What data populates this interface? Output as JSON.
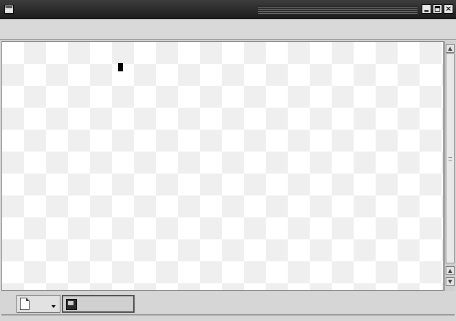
{
  "window": {
    "title": "",
    "buttons": {
      "minimize": "minimize-icon",
      "maximize": "maximize-icon",
      "close": "×"
    }
  },
  "menu": [
    {
      "label": ""
    },
    {
      "label": ""
    },
    {
      "label": ""
    },
    {
      "label": ""
    }
  ],
  "terminal": {
    "lines": [
      "",
      "",
      ""
    ],
    "cursor": "block-cursor"
  },
  "tabs": [
    {
      "label": ""
    },
    {
      "label": ""
    }
  ],
  "colors": {
    "titlebar": "#2a2a2a",
    "menubar": "#d9d9d9",
    "terminal_bg": "#ffffff",
    "terminal_fg": "#000000"
  }
}
